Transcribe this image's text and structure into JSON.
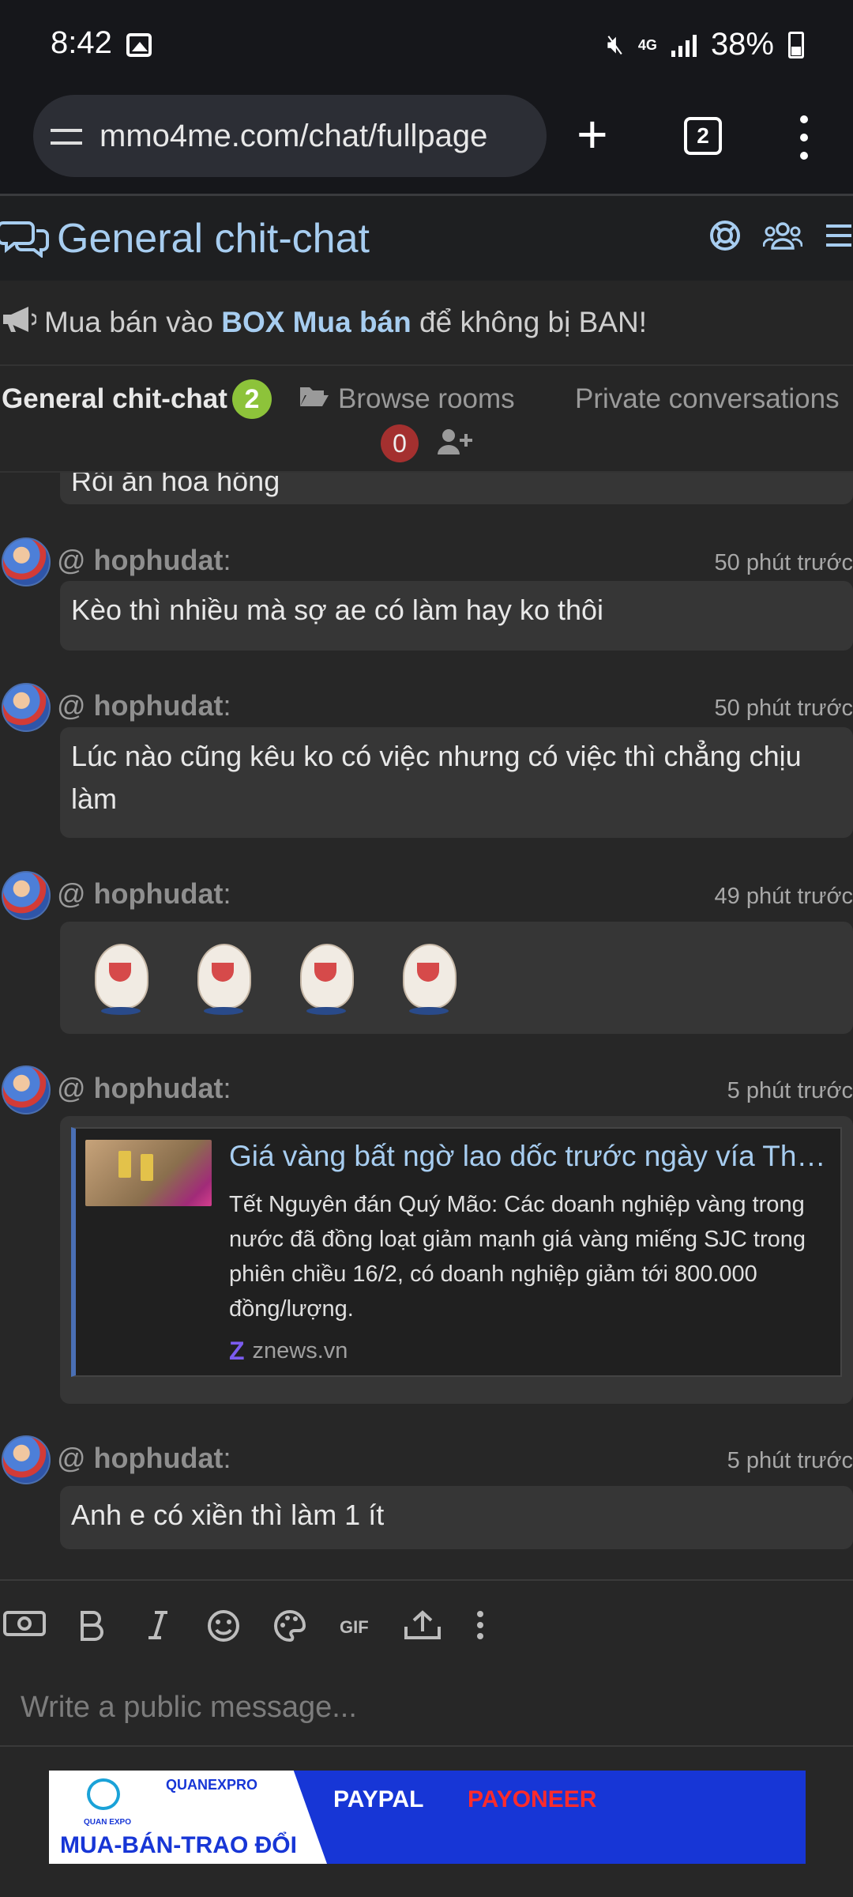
{
  "status": {
    "time": "8:42",
    "network": "4G",
    "battery": "38%"
  },
  "browser": {
    "url": "mmo4me.com/chat/fullpage",
    "tab_count": "2"
  },
  "chat": {
    "title": "General chit-chat",
    "notice": {
      "prefix": "Mua bán vào ",
      "highlight": "BOX Mua bán",
      "suffix": " để không bị BAN!"
    },
    "tabs": {
      "general": "General chit-chat",
      "general_badge": "2",
      "browse": "Browse rooms",
      "private": "Private conversations",
      "private_badge": "0"
    }
  },
  "messages": [
    {
      "text": "Rồi ăn hoa hồng"
    },
    {
      "author": "hophudat",
      "time": "50 phút trước",
      "text": "Kèo thì nhiều mà sợ ae có làm hay ko thôi"
    },
    {
      "author": "hophudat",
      "time": "50 phút trước",
      "text": "Lúc nào cũng kêu ko có việc nhưng có việc thì chẳng chịu làm"
    },
    {
      "author": "hophudat",
      "time": "49 phút trước",
      "sticker_count": 4
    },
    {
      "author": "hophudat",
      "time": "5 phút trước",
      "link_card": {
        "title": "Giá vàng bất ngờ lao dốc trước ngày vía Thần Tài",
        "description": "Tết Nguyên đán Quý Mão: Các doanh nghiệp vàng trong nước đã đồng loạt giảm mạnh giá vàng miếng SJC trong phiên chiều 16/2, có doanh nghiệp giảm tới 800.000 đồng/lượng.",
        "site": "znews.vn"
      }
    },
    {
      "author": "hophudat",
      "time": "5 phút trước",
      "text": "Anh e có xiền thì làm 1 ít"
    }
  ],
  "composer": {
    "placeholder": "Write a public message...",
    "gif_label": "GIF"
  },
  "ad": {
    "brand": "QUANEXPRO",
    "logo_text": "QUAN EXPO",
    "tagline": "MUA-BÁN-TRAO ĐỔI",
    "paypal": "PAYPAL",
    "payoneer": "PAYONEER"
  },
  "colors": {
    "accent": "#a7cdf0",
    "badge_green": "#8dc33a",
    "badge_red": "#a4302f",
    "ad_blue": "#1736d6"
  }
}
